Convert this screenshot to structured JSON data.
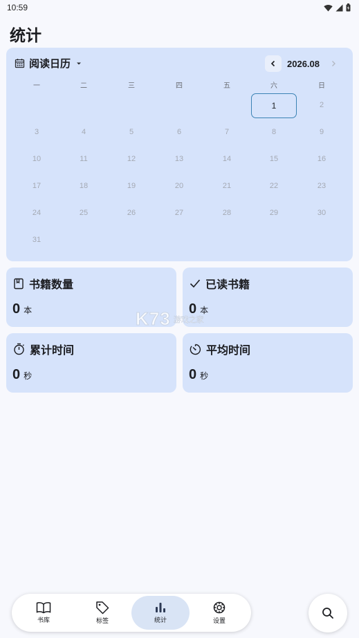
{
  "status_bar": {
    "time": "10:59"
  },
  "page_title": "统计",
  "calendar": {
    "title": "阅读日历",
    "month": "2026.08",
    "weekdays": [
      "一",
      "二",
      "三",
      "四",
      "五",
      "六",
      "日"
    ],
    "days": [
      "1",
      "2",
      "3",
      "4",
      "5",
      "6",
      "7",
      "8",
      "9",
      "10",
      "11",
      "12",
      "13",
      "14",
      "15",
      "16",
      "17",
      "18",
      "19",
      "20",
      "21",
      "22",
      "23",
      "24",
      "25",
      "26",
      "27",
      "28",
      "29",
      "30",
      "31"
    ],
    "today": "1"
  },
  "stats": {
    "book_count": {
      "title": "书籍数量",
      "value": "0",
      "unit": "本",
      "icon": "book-icon"
    },
    "read_books": {
      "title": "已读书籍",
      "value": "0",
      "unit": "本",
      "icon": "check-icon"
    },
    "total_time": {
      "title": "累计时间",
      "value": "0",
      "unit": "秒",
      "icon": "stopwatch-icon"
    },
    "avg_time": {
      "title": "平均时间",
      "value": "0",
      "unit": "秒",
      "icon": "timer-icon"
    }
  },
  "watermark": {
    "logo": "K73",
    "text": "游戏之家"
  },
  "bottom_nav": {
    "items": [
      {
        "label": "书库",
        "icon": "open-book-icon"
      },
      {
        "label": "标签",
        "icon": "tag-icon"
      },
      {
        "label": "统计",
        "icon": "bar-chart-icon"
      },
      {
        "label": "设置",
        "icon": "gear-icon"
      }
    ],
    "active": "统计"
  },
  "colors": {
    "card": "#d6e3fb",
    "background": "#f7f8fd",
    "active_nav": "#d9e4f5",
    "today_border": "#3a82b4"
  }
}
